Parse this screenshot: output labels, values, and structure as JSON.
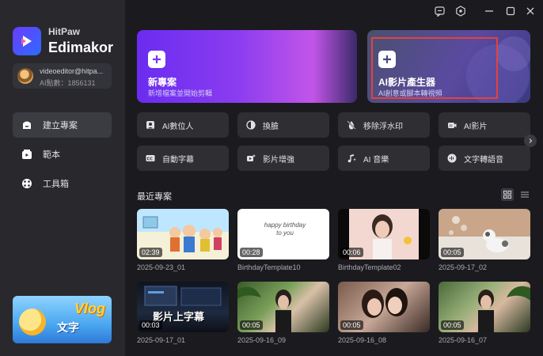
{
  "app": {
    "brand_line1": "HitPaw",
    "brand_line2": "Edimakor"
  },
  "user": {
    "email": "videoeditor@hitpa...",
    "points": "AI點數：1856131"
  },
  "sidebar": {
    "items": [
      {
        "label": "建立專案",
        "icon": "create-project-icon",
        "active": true
      },
      {
        "label": "範本",
        "icon": "template-icon",
        "active": false
      },
      {
        "label": "工具箱",
        "icon": "toolbox-icon",
        "active": false
      }
    ],
    "promo": {
      "title": "Vlog",
      "subtitle": "文字"
    }
  },
  "hero": {
    "new_project": {
      "title": "新專案",
      "subtitle": "新增檔案並開始剪輯"
    },
    "ai_video": {
      "title": "AI影片產生器",
      "subtitle": "AI創意或腳本轉視頻"
    }
  },
  "tools": [
    {
      "label": "AI數位人",
      "icon": "avatar-icon"
    },
    {
      "label": "換臉",
      "icon": "face-swap-icon"
    },
    {
      "label": "移除浮水印",
      "icon": "watermark-remove-icon"
    },
    {
      "label": "AI影片",
      "icon": "ai-video-icon"
    },
    {
      "label": "自動字幕",
      "icon": "caption-icon"
    },
    {
      "label": "影片增強",
      "icon": "enhance-icon"
    },
    {
      "label": "AI 音樂",
      "icon": "music-icon"
    },
    {
      "label": "文字轉語音",
      "icon": "tts-icon"
    }
  ],
  "recent": {
    "title": "最近專案",
    "projects": [
      {
        "name": "2025-09-23_01",
        "duration": "02:39",
        "overlay": ""
      },
      {
        "name": "BirthdayTemplate10",
        "duration": "00:28",
        "overlay": "happy birthday to you"
      },
      {
        "name": "BirthdayTemplate02",
        "duration": "00:06",
        "overlay": ""
      },
      {
        "name": "2025-09-17_02",
        "duration": "00:05",
        "overlay": ""
      },
      {
        "name": "2025-09-17_01",
        "duration": "00:03",
        "overlay": "影片上字幕"
      },
      {
        "name": "2025-09-16_09",
        "duration": "00:05",
        "overlay": ""
      },
      {
        "name": "2025-09-16_08",
        "duration": "00:05",
        "overlay": ""
      },
      {
        "name": "2025-09-16_07",
        "duration": "00:05",
        "overlay": ""
      }
    ]
  },
  "colors": {
    "highlight": "#e2433d",
    "accent_purple": "#7a36f0"
  }
}
